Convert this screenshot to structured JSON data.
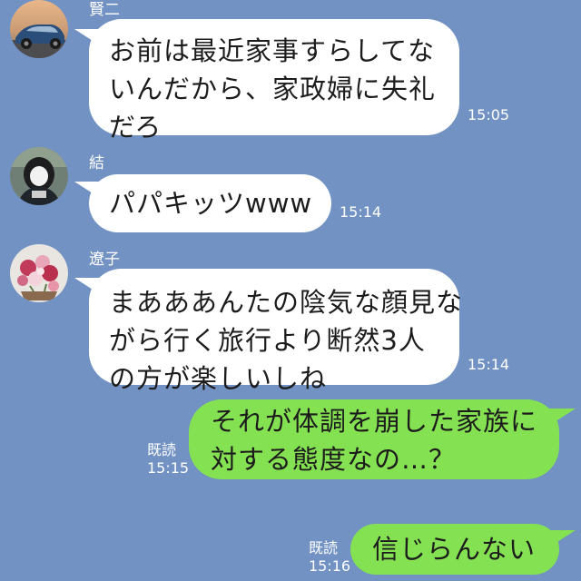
{
  "colors": {
    "background": "#7192c3",
    "incoming_bubble": "#ffffff",
    "outgoing_bubble": "#84e152",
    "meta_text": "#ffffff"
  },
  "messages": [
    {
      "direction": "incoming",
      "sender": "賢二",
      "avatar": "car-avatar",
      "lines": [
        "お前は最近家事すらしてな",
        "いんだから、家政婦に失礼",
        "だろ"
      ],
      "time": "15:05"
    },
    {
      "direction": "incoming",
      "sender": "結",
      "avatar": "girl-avatar",
      "lines": [
        "パパキッツwww"
      ],
      "time": "15:14"
    },
    {
      "direction": "incoming",
      "sender": "遼子",
      "avatar": "flowers-avatar",
      "lines": [
        "まあああんたの陰気な顔見な",
        "がら行く旅行より断然3人",
        "の方が楽しいしね"
      ],
      "time": "15:14"
    },
    {
      "direction": "outgoing",
      "read_label": "既読",
      "lines": [
        "それが体調を崩した家族に",
        "対する態度なの…？"
      ],
      "time": "15:15"
    },
    {
      "direction": "outgoing",
      "read_label": "既読",
      "lines": [
        "信じらんない"
      ],
      "time": "15:16"
    }
  ]
}
